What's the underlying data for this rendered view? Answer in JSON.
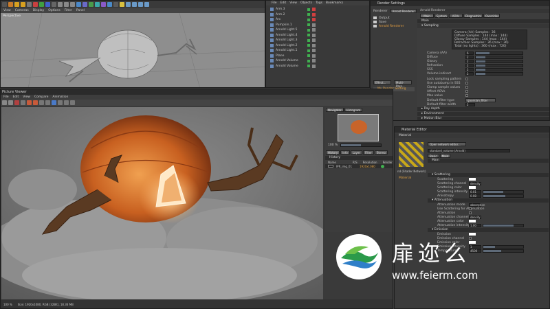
{
  "viewport": {
    "menu": [
      "View",
      "Cameras",
      "Display",
      "Options",
      "Filter",
      "Panel"
    ],
    "label": "Perspective"
  },
  "object_manager": {
    "menu": [
      "File",
      "Edit",
      "View",
      "Objects",
      "Tags",
      "Bookmarks"
    ],
    "objects": [
      "Arm.3",
      "Arm.2",
      "Arc",
      "Pumpkin.1",
      "Arnold Light.5",
      "Arnold Light.4",
      "Arnold Light.3",
      "Arnold Light.2",
      "Arnold Light.1",
      "Plane",
      "Arnold Volume",
      "Arnold Volume"
    ]
  },
  "render_settings": {
    "title": "Render Settings",
    "renderer_label": "Renderer",
    "renderer_value": "Arnold Renderer",
    "left_list": [
      "Output",
      "Save",
      "Arnold Renderer"
    ],
    "my_render_setting": "My Render Setting",
    "buttons": {
      "effect": "Effect...",
      "multipass": "Multi-Pass..."
    },
    "panel_title": "Arnold Renderer",
    "tabs": [
      "Main",
      "System",
      "AOVs",
      "Diagnostics",
      "Overrides"
    ],
    "main_label": "Main",
    "sampling_section": "Sampling",
    "sampling_info": [
      "Camera (AA) Samples : 36",
      "Diffuse Samples : 144 (max : 144)",
      "Glossy Samples : 144 (max : 144)",
      "Refraction Samples : 36 (max : 36)",
      "Total (no lights) : 360 (max : 720)"
    ],
    "params": [
      {
        "label": "Camera (AA)",
        "value": "6",
        "fill": 0.3
      },
      {
        "label": "Diffuse",
        "value": "2",
        "fill": 0.2
      },
      {
        "label": "Glossy",
        "value": "2",
        "fill": 0.2
      },
      {
        "label": "Refraction",
        "value": "2",
        "fill": 0.2
      },
      {
        "label": "SSS",
        "value": "2",
        "fill": 0.2
      },
      {
        "label": "Volume indirect",
        "value": "2",
        "fill": 0.2
      }
    ],
    "options": [
      "Lock sampling pattern",
      "Use autobump in SSS",
      "Clamp sample values",
      "Affect AOVs",
      "Max value"
    ],
    "filter_type_label": "Default filter",
    "filter_type_value": "type",
    "filter_name": "gaussian_filter",
    "filter_width_label": "Default filter",
    "filter_width_label2": "width",
    "filter_width_value": "2",
    "ray_depth": "Ray depth",
    "environment": "Environment",
    "motion_blur": "Motion Blur"
  },
  "picture_viewer": {
    "title": "Picture Viewer",
    "menu": [
      "File",
      "Edit",
      "View",
      "Compare",
      "Animation"
    ],
    "nav_tabs": [
      "Navigator",
      "Histogram"
    ],
    "zoom": "100 %",
    "history_tabs": [
      "History",
      "Info",
      "Layer",
      "Filter",
      "Stereo"
    ],
    "history_label": "History",
    "columns": [
      "Name",
      "R/S",
      "Resolution",
      "Render"
    ],
    "history_row": {
      "name": "IPR_img_01",
      "resolution": "1920x1080",
      "render": ""
    },
    "status": "100 %",
    "status_size": "Size: 1920x1080, RGB (32Bit), 18.36 MB"
  },
  "material_editor": {
    "title": "Material Editor",
    "header": "Material",
    "tabs": [
      "Basic",
      "Main"
    ],
    "main_label": "Main",
    "node_label": "nd (Shader Network)",
    "material_name": "Material",
    "open_network": "Open network editor...",
    "shader_field": "standard_volume (Arnold)",
    "sections": {
      "scattering": "Scattering",
      "attenuation": "Attenuation",
      "emission": "Emission"
    },
    "scattering_rows": [
      "Scattering",
      "Scattering channel",
      "Scattering color",
      "Scattering intensity",
      "Anisotropy"
    ],
    "scattering_values": {
      "channel": "density",
      "intensity": "0.01",
      "anisotropy": "0.08"
    },
    "attenuation_rows": [
      "Attenuation mode",
      "Use Scattering for Attenuation",
      "Attenuation",
      "Attenuation channel",
      "Attenuation color",
      "Attenuation intensity"
    ],
    "attenuation_values": {
      "mode": "absorption",
      "channel": "density",
      "intensity": "1.00"
    },
    "emission_rows": [
      "Emission",
      "Emission channel",
      "Emission color",
      "Emission intensity",
      "Temperature"
    ],
    "emission_values": {
      "intensity": "1",
      "temperature": "4500"
    }
  },
  "watermark": {
    "brand": "扉迩么",
    "url": "www.feierm.com"
  }
}
